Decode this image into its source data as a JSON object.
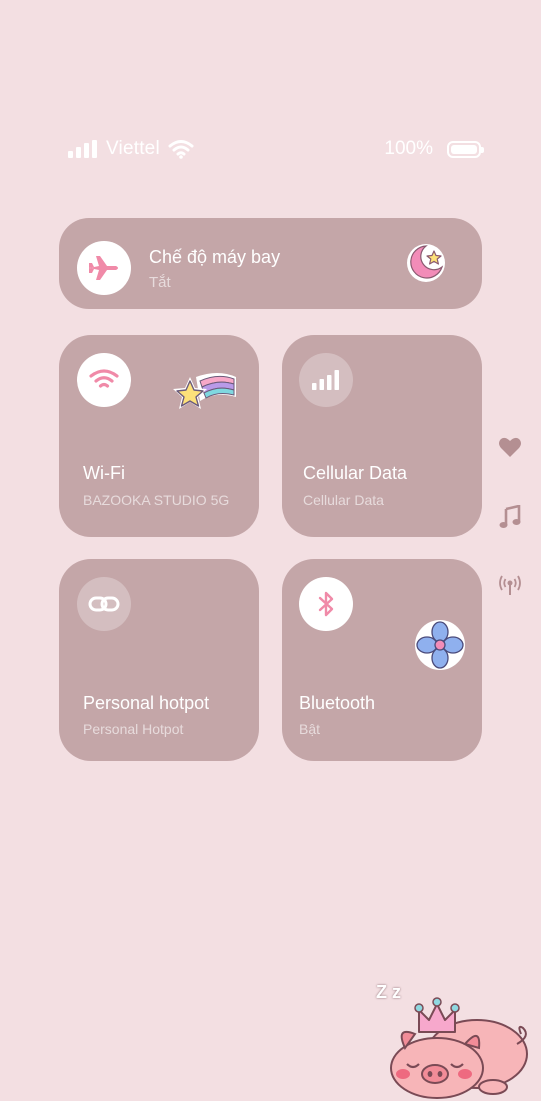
{
  "status_bar": {
    "carrier": "Viettel",
    "battery_percent_label": "100%",
    "battery_level": 1.0
  },
  "airplane": {
    "title": "Chế độ máy bay",
    "subtitle": "Tắt"
  },
  "wifi": {
    "title": "Wi-Fi",
    "subtitle": "BAZOOKA STUDIO 5G"
  },
  "cellular": {
    "title": "Cellular Data",
    "subtitle": "Cellular Data"
  },
  "hotspot": {
    "title": "Personal hotpot",
    "subtitle": "Personal Hotpot"
  },
  "bluetooth": {
    "title": "Bluetooth",
    "subtitle": "Bật"
  },
  "sleep_text": "Z z",
  "colors": {
    "background": "#f3dfe2",
    "tile": "#c4a6a8",
    "accent_pink": "#f08aa8",
    "side_icon": "#b48f92"
  },
  "icons": [
    "signal-icon",
    "wifi-icon",
    "battery-icon",
    "airplane-icon",
    "moon-star-sticker",
    "shooting-star-sticker",
    "cellular-bars-icon",
    "link-icon",
    "bluetooth-icon",
    "flower-sticker",
    "heart-icon",
    "music-note-icon",
    "broadcast-icon",
    "sleeping-pig-sticker"
  ]
}
